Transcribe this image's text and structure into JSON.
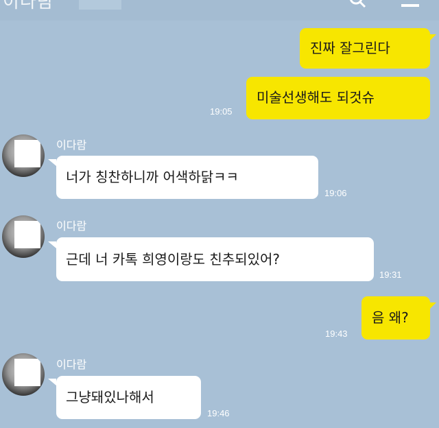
{
  "header": {
    "title": "이다람"
  },
  "messages": [
    {
      "from": "me",
      "text": "진짜 잘그린다"
    },
    {
      "from": "me",
      "text": "미술선생해도 되것슈",
      "time": "19:05"
    },
    {
      "from": "other",
      "name": "이다람",
      "text": "너가 칭찬하니까 어색하닭ㅋㅋ",
      "time": "19:06"
    },
    {
      "from": "other",
      "name": "이다람",
      "text": "근데 너 카톡 희영이랑도 친추되있어?",
      "time": "19:31"
    },
    {
      "from": "me",
      "text": "음 왜?",
      "time": "19:43"
    },
    {
      "from": "other",
      "name": "이다람",
      "text": "그냥돼있나해서",
      "time": "19:46"
    }
  ],
  "colors": {
    "background": "#a8c0d6",
    "my_bubble": "#f7e600",
    "other_bubble": "#ffffff"
  },
  "icons": {
    "search": "search-icon",
    "menu": "menu-icon"
  }
}
